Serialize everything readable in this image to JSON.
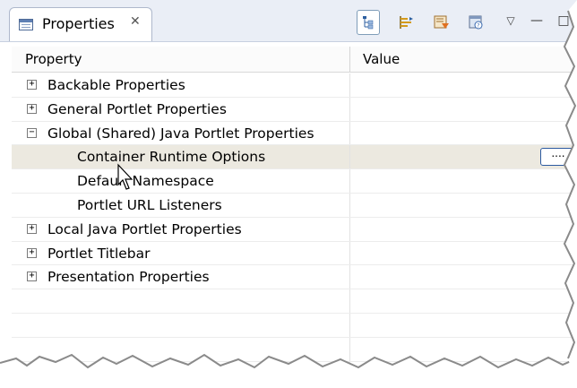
{
  "view": {
    "title": "Properties",
    "close_glyph": "✕",
    "toolbar": {
      "show_categories_icon": "tree-icon",
      "show_advanced_icon": "categories-icon",
      "filter_icon": "filter-icon",
      "restore_default_icon": "restore-icon",
      "view_menu_glyph": "▽",
      "minimize_glyph": "—",
      "maximize_glyph": "□"
    }
  },
  "table": {
    "columns": [
      "Property",
      "Value"
    ],
    "rows": [
      {
        "label": "Backable Properties",
        "expander": "+"
      },
      {
        "label": "General Portlet Properties",
        "expander": "+"
      },
      {
        "label": "Global (Shared) Java Portlet Properties",
        "expander": "−"
      },
      {
        "label": "Container Runtime Options",
        "value_button": "...."
      },
      {
        "label": "Default Namespace"
      },
      {
        "label": "Portlet URL Listeners"
      },
      {
        "label": "Local Java Portlet Properties",
        "expander": "+"
      },
      {
        "label": "Portlet Titlebar",
        "expander": "+"
      },
      {
        "label": "Presentation Properties",
        "expander": "+"
      }
    ]
  },
  "colors": {
    "tab_bar": "#eaeef6",
    "selected_row": "#ece9e0",
    "accent": "#2c5aa0"
  }
}
